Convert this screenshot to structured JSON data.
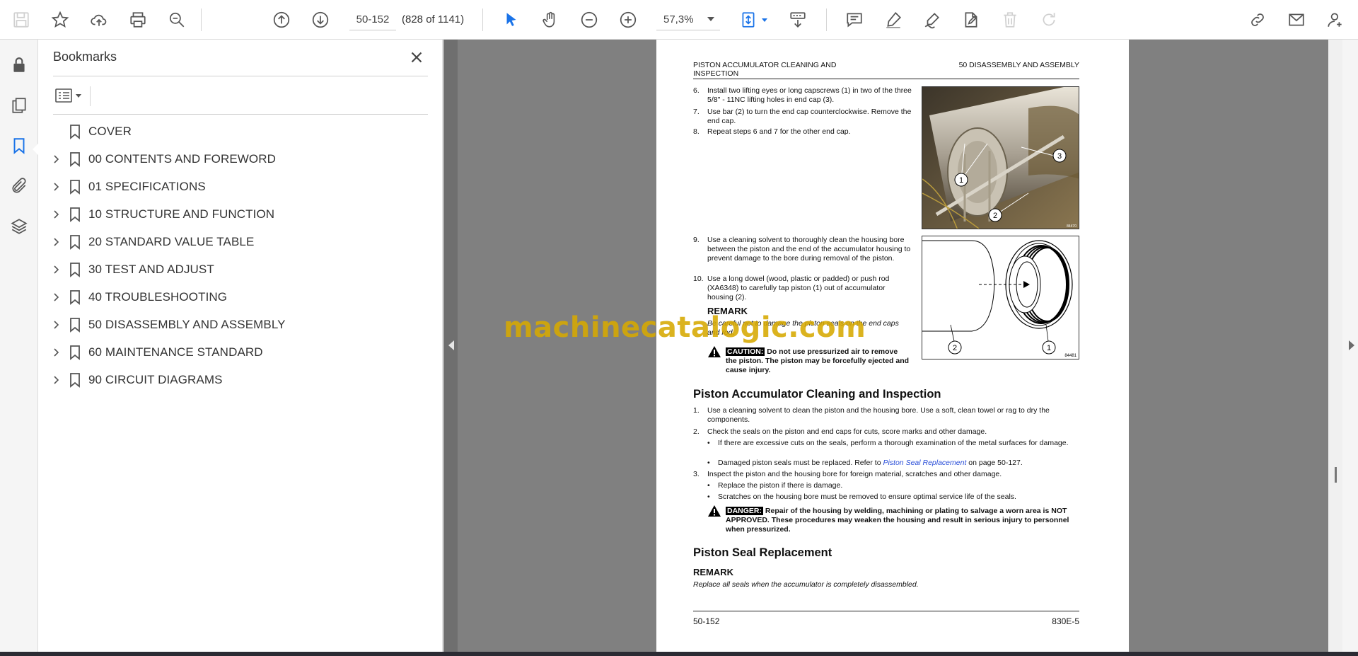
{
  "toolbar": {
    "page_input": "50-152",
    "page_count": "(828 of 1141)",
    "zoom": "57,3%",
    "icons": [
      "save-icon",
      "star-icon",
      "upload-icon",
      "print-icon",
      "search-zoom-icon",
      "arrow-up-icon",
      "arrow-down-icon",
      "select-cursor-icon",
      "hand-icon",
      "zoom-out-icon",
      "zoom-in-icon",
      "fit-page-icon",
      "scroll-mode-icon",
      "comment-icon",
      "highlight-icon",
      "sign-icon",
      "edit-document-icon",
      "trash-icon",
      "redo-icon",
      "share-link-icon",
      "mail-icon",
      "account-icon"
    ]
  },
  "rail": {
    "icons": [
      "lock-icon",
      "pages-icon",
      "bookmark-icon",
      "attachment-icon",
      "layers-icon"
    ]
  },
  "bookmarks": {
    "title": "Bookmarks",
    "items": [
      {
        "label": "COVER",
        "expandable": false
      },
      {
        "label": "00 CONTENTS AND FOREWORD",
        "expandable": true
      },
      {
        "label": "01 SPECIFICATIONS",
        "expandable": true
      },
      {
        "label": "10 STRUCTURE AND FUNCTION",
        "expandable": true
      },
      {
        "label": "20 STANDARD VALUE TABLE",
        "expandable": true
      },
      {
        "label": "30 TEST AND ADJUST",
        "expandable": true
      },
      {
        "label": "40 TROUBLESHOOTING",
        "expandable": true
      },
      {
        "label": "50 DISASSEMBLY AND ASSEMBLY",
        "expandable": true
      },
      {
        "label": "60 MAINTENANCE STANDARD",
        "expandable": true
      },
      {
        "label": "90 CIRCUIT DIAGRAMS",
        "expandable": true
      }
    ]
  },
  "page": {
    "header_left": "PISTON ACCUMULATOR CLEANING AND INSPECTION",
    "header_right": "50 DISASSEMBLY AND ASSEMBLY",
    "steps_a": [
      {
        "num": "6.",
        "text": "Install two lifting eyes or long capscrews (1) in two of the three 5/8\" - 11NC lifting holes in end cap (3)."
      },
      {
        "num": "7.",
        "text": "Use bar (2) to turn the end cap counterclockwise. Remove the end cap."
      },
      {
        "num": "8.",
        "text": "Repeat steps 6 and 7 for the other end cap."
      }
    ],
    "steps_b": [
      {
        "num": "9.",
        "text": "Use a cleaning solvent to thoroughly clean the housing bore between the piston and the end of the accumulator housing to prevent damage to the bore during removal of the piston."
      },
      {
        "num": "10.",
        "text": "Use a long dowel (wood, plastic or padded) or push rod (XA6348) to carefully tap piston (1) out of accumulator housing (2)."
      }
    ],
    "remark1_heading": "REMARK",
    "remark1_text": "Be careful not to damage the piston seals on the end caps and rod.",
    "caution_tag": "CAUTION:",
    "caution_text": " Do not use pressurized air to remove the piston. The piston may be forcefully ejected and cause injury.",
    "fig1_callouts": [
      "1",
      "2",
      "3"
    ],
    "fig1_code": "84470",
    "fig2_callouts": [
      "1",
      "2"
    ],
    "fig2_code": "84481",
    "section1_title": "Piston Accumulator Cleaning and Inspection",
    "inspect_steps": [
      {
        "num": "1.",
        "text": "Use a cleaning solvent to clean the piston and the housing bore. Use a soft, clean towel or rag to dry the components."
      },
      {
        "num": "2.",
        "text": "Check the seals on the piston and end caps for cuts, score marks and other damage."
      },
      {
        "num": "3.",
        "text": "Inspect the piston and the housing bore for foreign material, scratches and other damage."
      }
    ],
    "bullets_2": [
      "If there are excessive cuts on the seals, perform a thorough examination of the metal surfaces for damage."
    ],
    "bullet_2b_pre": "Damaged piston seals must be replaced. Refer to ",
    "bullet_2b_link": "Piston Seal Replacement",
    "bullet_2b_post": " on page 50-127.",
    "bullets_3": [
      "Replace the piston if there is damage.",
      "Scratches on the housing bore must be removed to ensure optimal service life of the seals."
    ],
    "danger_tag": "DANGER:",
    "danger_text": " Repair of the housing by welding, machining or plating to salvage a worn area is NOT APPROVED. These procedures may weaken the housing and result in serious injury to personnel when pressurized.",
    "section2_title": "Piston Seal Replacement",
    "remark2_heading": "REMARK",
    "remark2_text": "Replace all seals when the accumulator is completely disassembled.",
    "footer_left": "50-152",
    "footer_right": "830E-5"
  },
  "watermark": "machinecatalogic.com",
  "colors": {
    "accent": "#1a73e8",
    "watermark": "#d6a800",
    "link": "#2b4fd8"
  }
}
